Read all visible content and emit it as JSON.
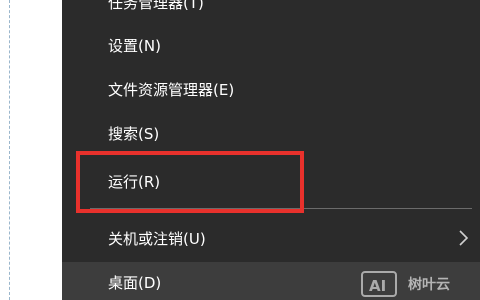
{
  "context_menu": {
    "items": [
      {
        "label": "任务管理器(T)"
      },
      {
        "label": "设置(N)"
      },
      {
        "label": "文件资源管理器(E)"
      },
      {
        "label": "搜索(S)"
      },
      {
        "label": "运行(R)"
      },
      {
        "label": "关机或注销(U)",
        "has_submenu": true,
        "submenu_icon": "chevron-right-icon"
      },
      {
        "label": "桌面(D)",
        "hovered": true
      }
    ],
    "highlighted_item": "运行(R)",
    "colors": {
      "menu_background": "#2b2b2b",
      "hover_background": "#3d3d3d",
      "text": "#ffffff",
      "annotation_box": "#e8312c",
      "separator": "#6b6b6b"
    }
  },
  "watermark": {
    "logo_text": "AI",
    "text": "树叶云"
  }
}
